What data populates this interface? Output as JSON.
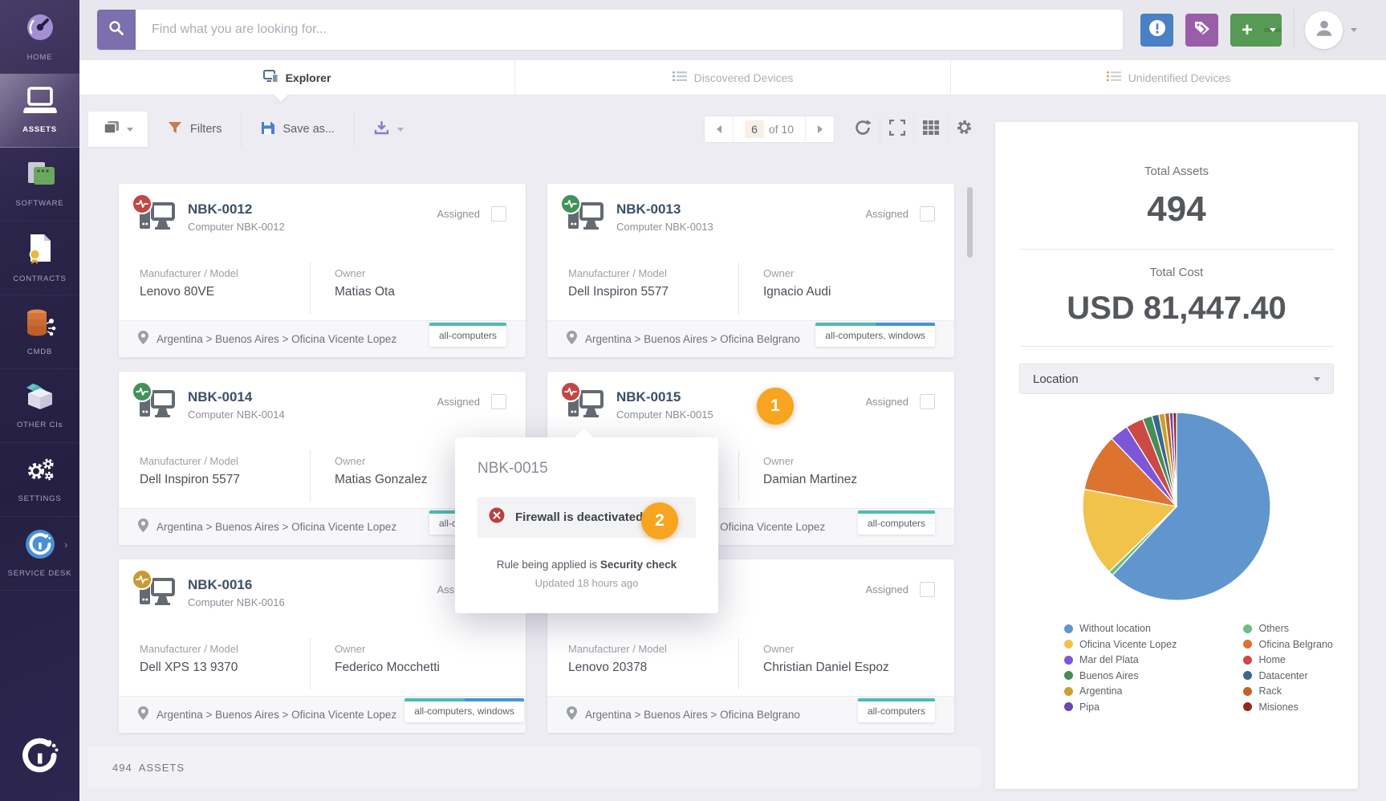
{
  "sidebar": {
    "items": [
      {
        "label": "HOME"
      },
      {
        "label": "ASSETS",
        "active": true
      },
      {
        "label": "SOFTWARE"
      },
      {
        "label": "CONTRACTS"
      },
      {
        "label": "CMDB"
      },
      {
        "label": "OTHER CIs"
      },
      {
        "label": "SETTINGS"
      },
      {
        "label": "SERVICE DESK"
      }
    ]
  },
  "topbar": {
    "search_placeholder": "Find what you are looking for..."
  },
  "tabs": {
    "explorer": "Explorer",
    "discovered": "Discovered Devices",
    "unidentified": "Unidentified Devices"
  },
  "toolbar": {
    "filters": "Filters",
    "save_as": "Save as...",
    "page_current": "6",
    "page_of": "of 10"
  },
  "card_labels": {
    "manufacturer": "Manufacturer / Model",
    "owner": "Owner",
    "assigned": "Assigned"
  },
  "cards": [
    {
      "title": "NBK-0012",
      "subtitle": "Computer NBK-0012",
      "status_color": "#c14744",
      "manufacturer": "Lenovo 80VE",
      "owner": "Matias Ota",
      "location": "Argentina > Buenos Aires > Oficina Vicente Lopez",
      "tag": "all-computers",
      "tag_colors": [
        "#4dbcb4"
      ]
    },
    {
      "title": "NBK-0013",
      "subtitle": "Computer NBK-0013",
      "status_color": "#41935a",
      "manufacturer": "Dell Inspiron 5577",
      "owner": "Ignacio Audi",
      "location": "Argentina > Buenos Aires > Oficina Belgrano",
      "tag": "all-computers, windows",
      "tag_colors": [
        "#4dbcb4",
        "#4594d9"
      ]
    },
    {
      "title": "NBK-0014",
      "subtitle": "Computer NBK-0014",
      "status_color": "#41935a",
      "manufacturer": "Dell Inspiron 5577",
      "owner": "Matias Gonzalez",
      "location": "Argentina > Buenos Aires > Oficina Vicente Lopez",
      "tag": "all-computers",
      "tag_colors": [
        "#4dbcb4"
      ]
    },
    {
      "title": "NBK-0015",
      "subtitle": "Computer NBK-0015",
      "status_color": "#c14744",
      "manufacturer": "",
      "owner": "Damian Martinez",
      "location": "Argentina > Buenos Aires > Oficina Vicente Lopez",
      "tag": "all-computers",
      "tag_colors": [
        "#4dbcb4"
      ]
    },
    {
      "title": "NBK-0016",
      "subtitle": "Computer NBK-0016",
      "status_color": "#c99a33",
      "manufacturer": "Dell XPS 13 9370",
      "owner": "Federico Mocchetti",
      "location": "Argentina > Buenos Aires > Oficina Vicente Lopez",
      "tag": "all-computers, windows",
      "tag_colors": [
        "#4dbcb4",
        "#4594d9"
      ]
    },
    {
      "title": "",
      "subtitle": "",
      "status_color": "",
      "manufacturer": "Lenovo 20378",
      "owner": "Christian Daniel Espoz",
      "location": "Argentina > Buenos Aires > Oficina Belgrano",
      "tag": "all-computers",
      "tag_colors": [
        "#4dbcb4"
      ]
    }
  ],
  "popup": {
    "title": "NBK-0015",
    "alert": "Firewall is deactivated",
    "rule_prefix": "Rule being applied is",
    "rule_name": "Security check",
    "updated": "Updated 18 hours ago"
  },
  "annotations": {
    "first": "1",
    "second": "2"
  },
  "panel": {
    "total_assets_label": "Total Assets",
    "total_assets_value": "494",
    "total_cost_label": "Total Cost",
    "total_cost_value": "USD 81,447.40",
    "location_filter": "Location"
  },
  "chart_data": {
    "type": "pie",
    "total": 494,
    "legend_position": "bottom",
    "series": [
      {
        "label": "Without location",
        "value": 306,
        "color": "#6195ce"
      },
      {
        "label": "Others",
        "value": 4,
        "color": "#6cbe85"
      },
      {
        "label": "Oficina Vicente Lopez",
        "value": 75,
        "color": "#f2c34b"
      },
      {
        "label": "Oficina Belgrano",
        "value": 49,
        "color": "#dc7430"
      },
      {
        "label": "Mar del Plata",
        "value": 16,
        "color": "#7d57d8"
      },
      {
        "label": "Home",
        "value": 15,
        "color": "#cc4a45"
      },
      {
        "label": "Buenos Aires",
        "value": 8,
        "color": "#478d57"
      },
      {
        "label": "Datacenter",
        "value": 6,
        "color": "#39688e"
      },
      {
        "label": "Argentina",
        "value": 5,
        "color": "#c9a02e"
      },
      {
        "label": "Rack",
        "value": 4,
        "color": "#c06527"
      },
      {
        "label": "Pipa",
        "value": 3,
        "color": "#6847b0"
      },
      {
        "label": "Misiones",
        "value": 3,
        "color": "#8e2b21"
      }
    ],
    "legend_order": [
      "Without location",
      "Oficina Vicente Lopez",
      "Mar del Plata",
      "Buenos Aires",
      "Argentina",
      "Pipa",
      "Others",
      "Oficina Belgrano",
      "Home",
      "Datacenter",
      "Rack",
      "Misiones"
    ]
  },
  "footer": {
    "count": "494",
    "label": "ASSETS"
  }
}
